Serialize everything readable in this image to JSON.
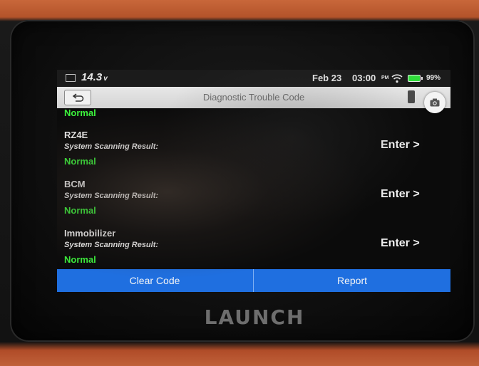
{
  "device": {
    "brand": "LAUNCH"
  },
  "status_bar": {
    "voltage": "14.3",
    "voltage_unit": "v",
    "date": "Feb 23",
    "time": "03:00",
    "ampm": "PM",
    "battery_percent": "99%",
    "icons": [
      "battery-voltage-icon",
      "wifi-icon",
      "battery-icon"
    ]
  },
  "title_bar": {
    "title": "Diagnostic Trouble Code",
    "icons": [
      "back-arrow-icon",
      "camera-icon"
    ]
  },
  "list": {
    "previous_status": "Normal",
    "items": [
      {
        "name": "RZ4E",
        "scan_label": "System Scanning Result:",
        "status": "Normal",
        "action": "Enter >"
      },
      {
        "name": "BCM",
        "scan_label": "System Scanning Result:",
        "status": "Normal",
        "action": "Enter >"
      },
      {
        "name": "Immobilizer",
        "scan_label": "System Scanning Result:",
        "status": "Normal",
        "action": "Enter >"
      }
    ]
  },
  "actions": {
    "clear_code": "Clear Code",
    "report": "Report"
  },
  "colors": {
    "status_normal": "#3cf23c",
    "action_bar": "#1f6fe0",
    "title_bar": "#e0e0e0"
  }
}
